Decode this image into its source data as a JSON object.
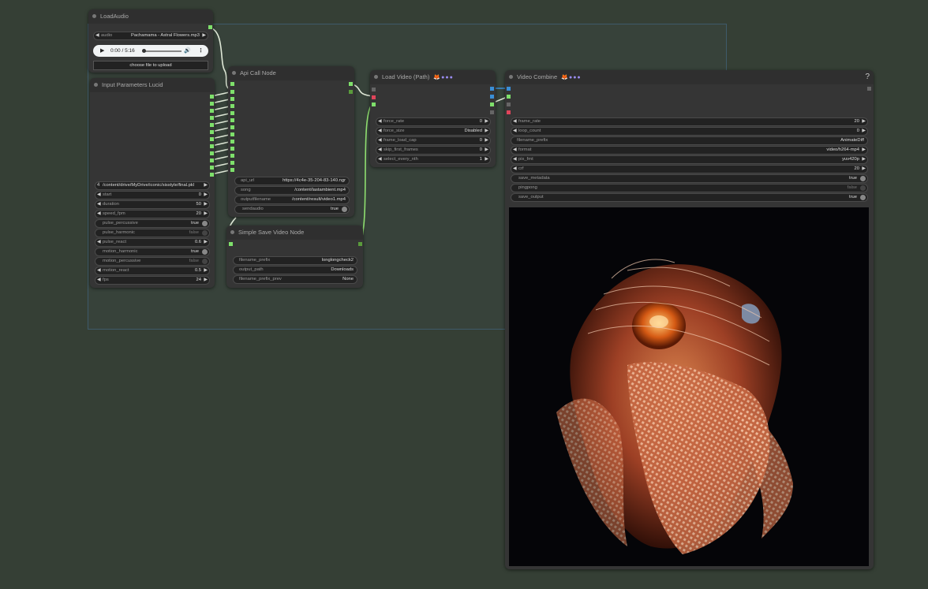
{
  "colors": {
    "canvas": "#353f35",
    "node": "#353535",
    "link_green": "#8fe070",
    "link_blue": "#3a8fd6",
    "toggle_on": "#8a8a8a"
  },
  "nodes": {
    "load_audio": {
      "title": "LoadAudio",
      "audio": {
        "label": "audio",
        "value": "Pachamama - Astral Flowers.mp3"
      },
      "player": {
        "time": "0:00 / 5:16",
        "play_icon": "play-icon",
        "volume_icon": "volume-icon",
        "more_icon": "more-icon"
      },
      "upload_label": "choose file to upload"
    },
    "input_params": {
      "title": "Input Parameters Lucid",
      "path_value": "/content/drive/MyDrive/iconic/sisstyle/final.pkl",
      "path_overlay": "4",
      "widgets": [
        {
          "label": "start",
          "value": "0"
        },
        {
          "label": "duration",
          "value": "50"
        },
        {
          "label": "speed_fpm",
          "value": "20"
        },
        {
          "label": "pulse_percussive",
          "value": "true"
        },
        {
          "label": "pulse_harmonic",
          "value": "false"
        },
        {
          "label": "pulse_react",
          "value": "0.6"
        },
        {
          "label": "motion_harmonic",
          "value": "true"
        },
        {
          "label": "motion_percussive",
          "value": "false"
        },
        {
          "label": "motion_react",
          "value": "0.5"
        },
        {
          "label": "fps",
          "value": "24"
        }
      ]
    },
    "api_call": {
      "title": "Api Call Node",
      "widgets": [
        {
          "label": "api_url",
          "value": "https://4c4e-35-204-83-140.ngr"
        },
        {
          "label": "song",
          "value": "/content/lastambient.mp4"
        },
        {
          "label": "outputfilename",
          "value": "/content/result/video1.mp4"
        },
        {
          "label": "sendaudio",
          "value": "true"
        }
      ]
    },
    "simple_save": {
      "title": "Simple Save Video Node",
      "widgets": [
        {
          "label": "filename_prefix",
          "value": "longlongcheck2"
        },
        {
          "label": "output_path",
          "value": "Downloads"
        },
        {
          "label": "filename_prefix_prev",
          "value": "None"
        }
      ]
    },
    "load_video": {
      "title": "Load Video (Path)",
      "badge": "🦊●●●",
      "widgets": [
        {
          "label": "force_rate",
          "value": "0"
        },
        {
          "label": "force_size",
          "value": "Disabled"
        },
        {
          "label": "frame_load_cap",
          "value": "0"
        },
        {
          "label": "skip_first_frames",
          "value": "0"
        },
        {
          "label": "select_every_nth",
          "value": "1"
        }
      ]
    },
    "video_combine": {
      "title": "Video Combine",
      "badge": "🦊●●●",
      "help": "?",
      "widgets": [
        {
          "label": "frame_rate",
          "value": "20"
        },
        {
          "label": "loop_count",
          "value": "0"
        },
        {
          "label": "filename_prefix",
          "value": "AnimateDiff"
        },
        {
          "label": "format",
          "value": "video/h264-mp4"
        },
        {
          "label": "pix_fmt",
          "value": "yuv420p"
        },
        {
          "label": "crf",
          "value": "20"
        },
        {
          "label": "save_metadata",
          "value": "true"
        },
        {
          "label": "pingpong",
          "value": "false"
        },
        {
          "label": "save_output",
          "value": "true"
        }
      ]
    }
  }
}
